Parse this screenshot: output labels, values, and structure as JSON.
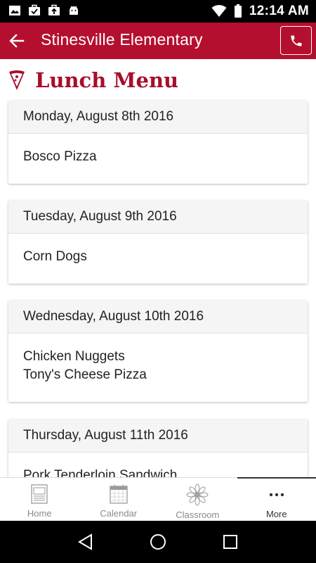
{
  "status_bar": {
    "time": "12:14 AM"
  },
  "app_bar": {
    "title": "Stinesville Elementary"
  },
  "page": {
    "heading": "Lunch Menu"
  },
  "menu_days": [
    {
      "date": "Monday, August 8th 2016",
      "items": [
        "Bosco Pizza"
      ]
    },
    {
      "date": "Tuesday, August 9th 2016",
      "items": [
        "Corn Dogs"
      ]
    },
    {
      "date": "Wednesday, August 10th 2016",
      "items": [
        "Chicken Nuggets",
        "Tony's Cheese Pizza"
      ]
    },
    {
      "date": "Thursday, August 11th 2016",
      "items": [
        "Pork Tenderloin Sandwich"
      ]
    }
  ],
  "bottom_nav": {
    "home": "Home",
    "calendar": "Calendar",
    "classroom": "Classroom",
    "more": "More"
  },
  "colors": {
    "brand": "#b40f2f",
    "heading": "#a80d2b"
  }
}
